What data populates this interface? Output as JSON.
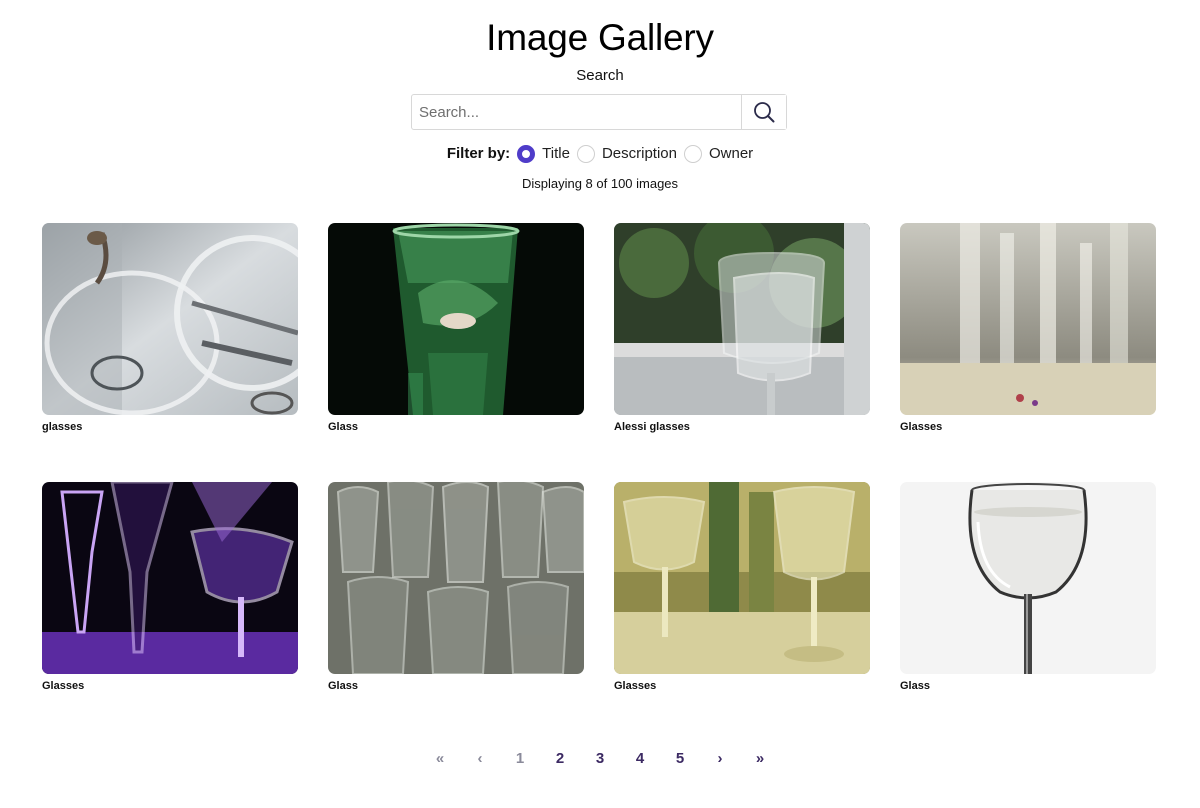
{
  "header": {
    "title": "Image Gallery"
  },
  "search": {
    "label": "Search",
    "placeholder": "Search...",
    "value": ""
  },
  "filter": {
    "label": "Filter by:",
    "options": [
      {
        "label": "Title",
        "checked": true
      },
      {
        "label": "Description",
        "checked": false
      },
      {
        "label": "Owner",
        "checked": false
      }
    ]
  },
  "status": {
    "count_text": "Displaying 8 of 100 images"
  },
  "gallery": {
    "items": [
      {
        "caption": "glasses"
      },
      {
        "caption": "Glass"
      },
      {
        "caption": "Alessi glasses"
      },
      {
        "caption": "Glasses"
      },
      {
        "caption": "Glasses"
      },
      {
        "caption": "Glass"
      },
      {
        "caption": "Glasses"
      },
      {
        "caption": "Glass"
      }
    ]
  },
  "pagination": {
    "first": "«",
    "prev": "‹",
    "pages": [
      "1",
      "2",
      "3",
      "4",
      "5"
    ],
    "current": "1",
    "next": "›",
    "last": "»"
  },
  "colors": {
    "accent": "#4f3cc9",
    "pagination": "#3c2a63"
  }
}
